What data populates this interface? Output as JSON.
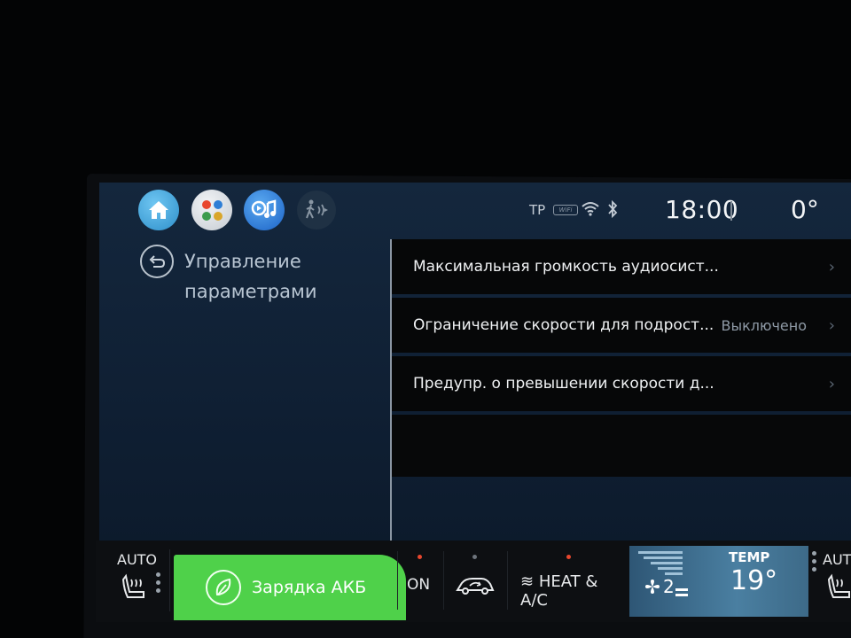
{
  "topbar": {
    "tp": "TP",
    "wifi_badge": "WiFi",
    "clock": "18:00",
    "outside_temp": "0°"
  },
  "page": {
    "title": "Управление параметрами"
  },
  "settings": [
    {
      "label": "Максимальная громкость аудиосист...",
      "value": ""
    },
    {
      "label": "Ограничение скорости для подрост...",
      "value": "Выключено"
    },
    {
      "label": "Предупр. о превышении скорости д...",
      "value": ""
    }
  ],
  "climate": {
    "seat_left_auto": "AUTO",
    "charge_label": "Зарядка АКБ",
    "on_label": "ON",
    "heat_ac_label": "HEAT & A/C",
    "fan_speed": "2",
    "temp_label": "TEMP",
    "temp_value": "19°",
    "seat_right_auto": "AUTO"
  },
  "colors": {
    "charge_green": "#4fd14a",
    "led_red": "#e8472e",
    "led_gray": "#6d747c",
    "fan_panel": "#4a7fa1"
  },
  "icons": [
    "home-icon",
    "apps-icon",
    "media-icon",
    "pedestrian-alert-icon",
    "wifi-icon",
    "bluetooth-icon",
    "back-icon",
    "chevron-right-icon",
    "leaf-icon",
    "seat-heat-icon",
    "recirculation-icon",
    "fan-icon"
  ]
}
